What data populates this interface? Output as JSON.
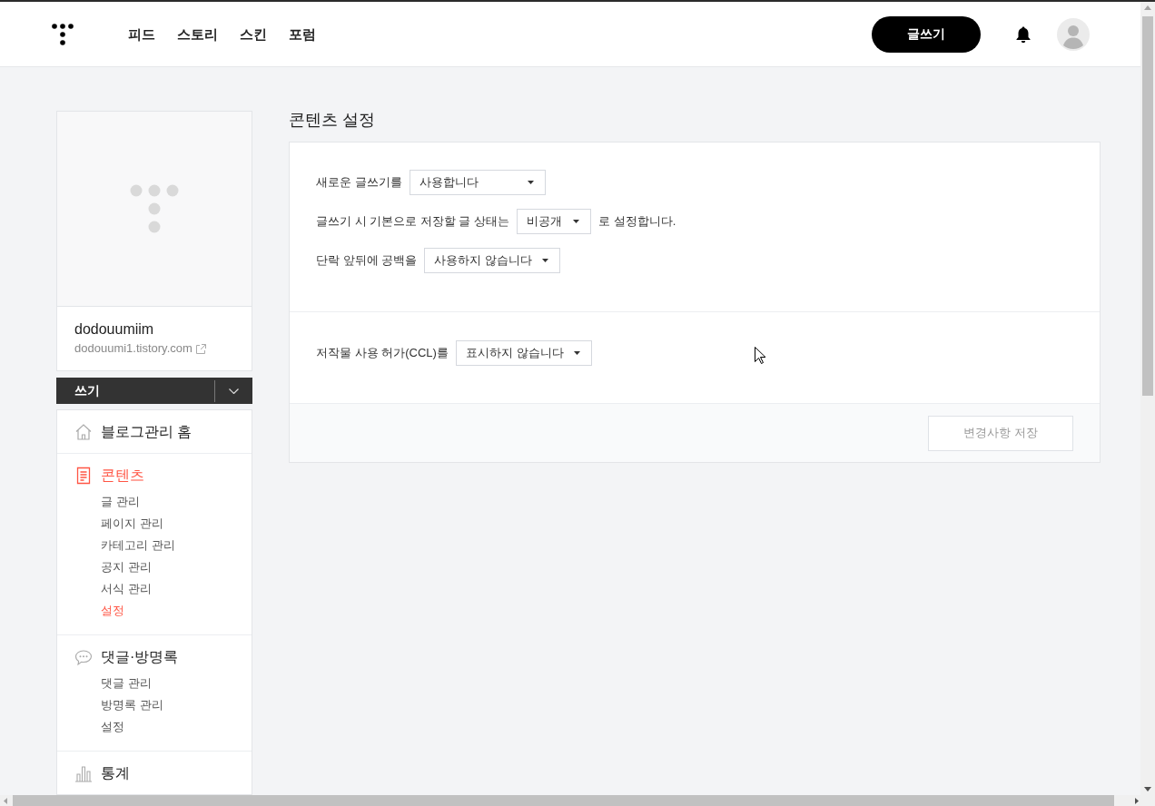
{
  "header": {
    "nav": [
      {
        "label": "피드"
      },
      {
        "label": "스토리"
      },
      {
        "label": "스킨"
      },
      {
        "label": "포럼"
      }
    ],
    "write_button": "글쓰기"
  },
  "sidebar": {
    "blog_name": "dodouumiim",
    "blog_url": "dodouumi1.tistory.com",
    "write_button": "쓰기",
    "menu": [
      {
        "kind": "home",
        "label": "블로그관리 홈",
        "selected": false
      },
      {
        "kind": "document",
        "label": "콘텐츠",
        "selected": true,
        "children": [
          {
            "label": "글 관리",
            "selected": false
          },
          {
            "label": "페이지 관리",
            "selected": false
          },
          {
            "label": "카테고리 관리",
            "selected": false
          },
          {
            "label": "공지 관리",
            "selected": false
          },
          {
            "label": "서식 관리",
            "selected": false
          },
          {
            "label": "설정",
            "selected": true
          }
        ]
      },
      {
        "kind": "comment",
        "label": "댓글·방명록",
        "selected": false,
        "children": [
          {
            "label": "댓글 관리",
            "selected": false
          },
          {
            "label": "방명록 관리",
            "selected": false
          },
          {
            "label": "설정",
            "selected": false
          }
        ]
      },
      {
        "kind": "chart",
        "label": "통계",
        "selected": false
      }
    ]
  },
  "main": {
    "title": "콘텐츠 설정",
    "sections": [
      {
        "rows": [
          {
            "parts": [
              {
                "kind": "text",
                "text": "새로운 글쓰기를"
              },
              {
                "kind": "select",
                "value": "사용합니다"
              }
            ]
          },
          {
            "parts": [
              {
                "kind": "text",
                "text": "글쓰기 시 기본으로 저장할 글 상태는"
              },
              {
                "kind": "select",
                "value": "비공개"
              },
              {
                "kind": "text",
                "text": "로 설정합니다."
              }
            ]
          },
          {
            "parts": [
              {
                "kind": "text",
                "text": "단락 앞뒤에 공백을"
              },
              {
                "kind": "select",
                "value": "사용하지 않습니다"
              }
            ]
          }
        ]
      },
      {
        "rows": [
          {
            "parts": [
              {
                "kind": "text",
                "text": "저작물 사용 허가(CCL)를"
              },
              {
                "kind": "select",
                "value": "표시하지 않습니다"
              }
            ]
          }
        ]
      }
    ],
    "save_button": {
      "label": "변경사항 저장",
      "disabled": true
    }
  }
}
